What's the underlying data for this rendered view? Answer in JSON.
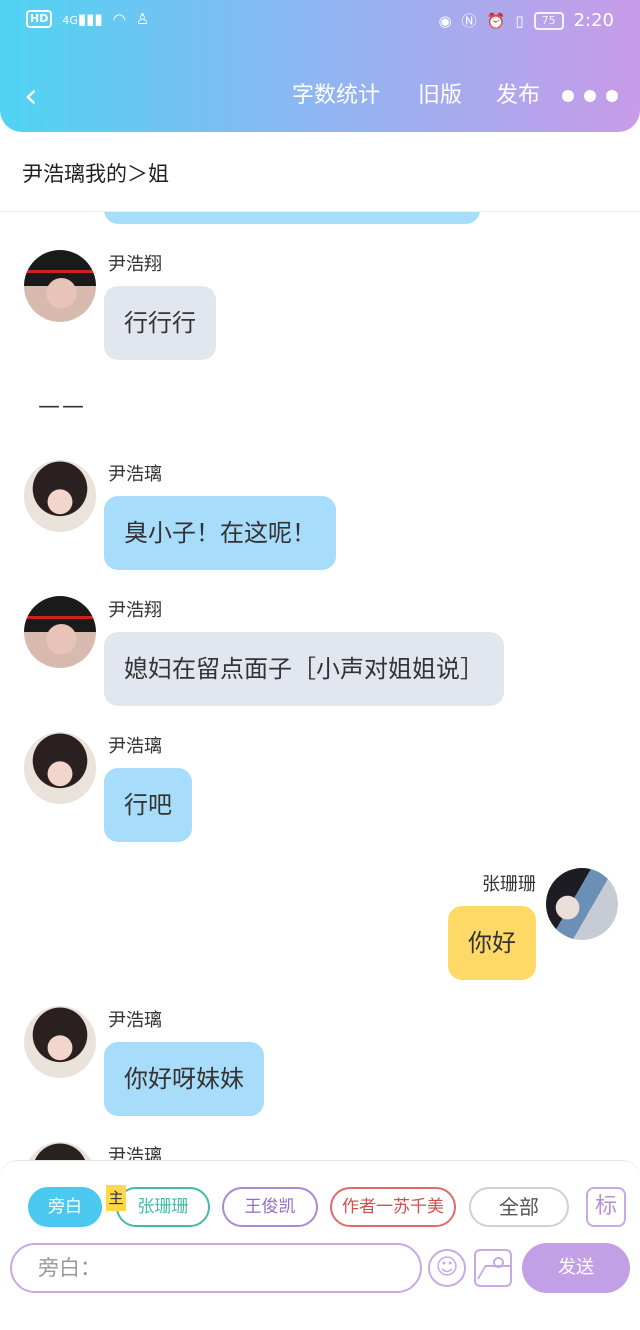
{
  "status_bar": {
    "left_icons": [
      "hd-icon",
      "signal-icon",
      "wifi-icon",
      "qq-icon"
    ],
    "hd_label": "HD",
    "network_label": "4G",
    "right_icons": [
      "eye-icon",
      "nfc-icon",
      "alarm-icon",
      "vibrate-icon"
    ],
    "battery": "75",
    "time": "2:20"
  },
  "toolbar": {
    "word_count": "字数统计",
    "old_version": "旧版",
    "publish": "发布"
  },
  "story": {
    "title": "尹浩璃我的＞姐"
  },
  "narration": "——",
  "messages": [
    {
      "name": "尹浩翔",
      "text": "行行行",
      "style": "gray"
    },
    {
      "name": "尹浩璃",
      "text": "臭小子！在这呢！",
      "style": "blue"
    },
    {
      "name": "尹浩翔",
      "text": "媳妇在留点面子［小声对姐姐说］",
      "style": "gray"
    },
    {
      "name": "尹浩璃",
      "text": "行吧",
      "style": "blue"
    },
    {
      "name": "张珊珊",
      "text": "你好",
      "style": "yellow"
    },
    {
      "name": "尹浩璃",
      "text": "你好呀妹妹",
      "style": "blue"
    },
    {
      "name": "尹浩璃",
      "text": "",
      "style": "blue"
    }
  ],
  "role_bar": {
    "narrator": "旁白",
    "main_badge": "主",
    "roles": [
      "张珊珊",
      "王俊凯",
      "作者一苏千美"
    ],
    "all": "全部",
    "mark": "标"
  },
  "composer": {
    "placeholder": "旁白：",
    "send": "发送"
  },
  "colors": {
    "header_start": "#4fd3f3",
    "header_end": "#c89be8",
    "bubble_blue": "#a8dcfb",
    "bubble_gray": "#e2e6ee",
    "bubble_yellow": "#ffd968",
    "accent_purple": "#c3a0e6"
  }
}
